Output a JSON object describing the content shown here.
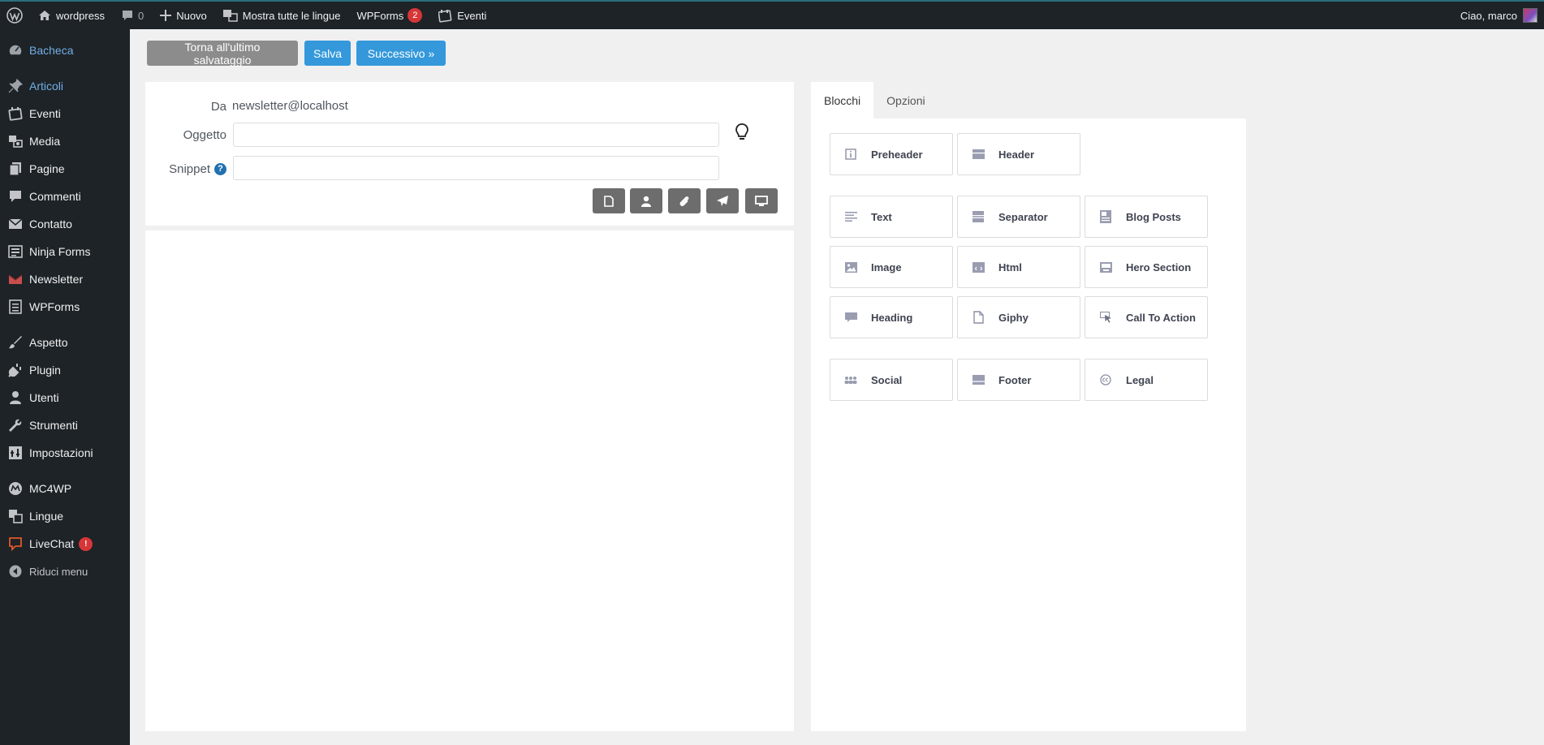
{
  "adminbar": {
    "site_name": "wordpress",
    "comments_count": "0",
    "new_label": "Nuovo",
    "languages_label": "Mostra tutte le lingue",
    "wpforms_label": "WPForms",
    "wpforms_count": "2",
    "events_label": "Eventi",
    "greeting": "Ciao, marco"
  },
  "sidebar": {
    "items": [
      {
        "label": "Bacheca",
        "icon": "dashboard-icon"
      },
      {
        "label": "Articoli",
        "icon": "pin-icon"
      },
      {
        "label": "Eventi",
        "icon": "calendar-icon"
      },
      {
        "label": "Media",
        "icon": "media-icon"
      },
      {
        "label": "Pagine",
        "icon": "pages-icon"
      },
      {
        "label": "Commenti",
        "icon": "comments-icon"
      },
      {
        "label": "Contatto",
        "icon": "mail-icon"
      },
      {
        "label": "Ninja Forms",
        "icon": "forms-icon"
      },
      {
        "label": "Newsletter",
        "icon": "newsletter-icon"
      },
      {
        "label": "WPForms",
        "icon": "wpforms-icon"
      },
      {
        "label": "Aspetto",
        "icon": "brush-icon"
      },
      {
        "label": "Plugin",
        "icon": "plugin-icon"
      },
      {
        "label": "Utenti",
        "icon": "users-icon"
      },
      {
        "label": "Strumenti",
        "icon": "wrench-icon"
      },
      {
        "label": "Impostazioni",
        "icon": "settings-icon"
      },
      {
        "label": "MC4WP",
        "icon": "mc4wp-icon"
      },
      {
        "label": "Lingue",
        "icon": "translate-icon"
      },
      {
        "label": "LiveChat",
        "icon": "chat-icon",
        "badge": "!"
      },
      {
        "label": "Riduci menu",
        "icon": "collapse-icon"
      }
    ]
  },
  "toolbar": {
    "back_label": "Torna all'ultimo salvataggio",
    "save_label": "Salva",
    "next_label": "Successivo »"
  },
  "form": {
    "from_label": "Da",
    "from_value": "newsletter@localhost",
    "subject_label": "Oggetto",
    "subject_value": "",
    "snippet_label": "Snippet",
    "snippet_value": ""
  },
  "tabs": [
    "Blocchi",
    "Opzioni"
  ],
  "blocks": [
    {
      "label": "Preheader",
      "icon": "info-icon"
    },
    {
      "label": "Header",
      "icon": "header-icon"
    },
    {
      "label": "Text",
      "icon": "text-lines-icon"
    },
    {
      "label": "Separator",
      "icon": "separator-icon"
    },
    {
      "label": "Blog Posts",
      "icon": "blog-posts-icon"
    },
    {
      "label": "Image",
      "icon": "image-icon"
    },
    {
      "label": "Html",
      "icon": "html-icon"
    },
    {
      "label": "Hero Section",
      "icon": "hero-icon"
    },
    {
      "label": "Heading",
      "icon": "heading-icon"
    },
    {
      "label": "Giphy",
      "icon": "file-icon"
    },
    {
      "label": "Call To Action",
      "icon": "cursor-icon"
    },
    {
      "label": "Social",
      "icon": "social-icon"
    },
    {
      "label": "Footer",
      "icon": "footer-icon"
    },
    {
      "label": "Legal",
      "icon": "cc-icon"
    }
  ],
  "colors": {
    "adminbar_bg": "#1d2327",
    "accent_blue": "#3498db",
    "current_menu": "#72aee6",
    "badge_red": "#d63638"
  }
}
